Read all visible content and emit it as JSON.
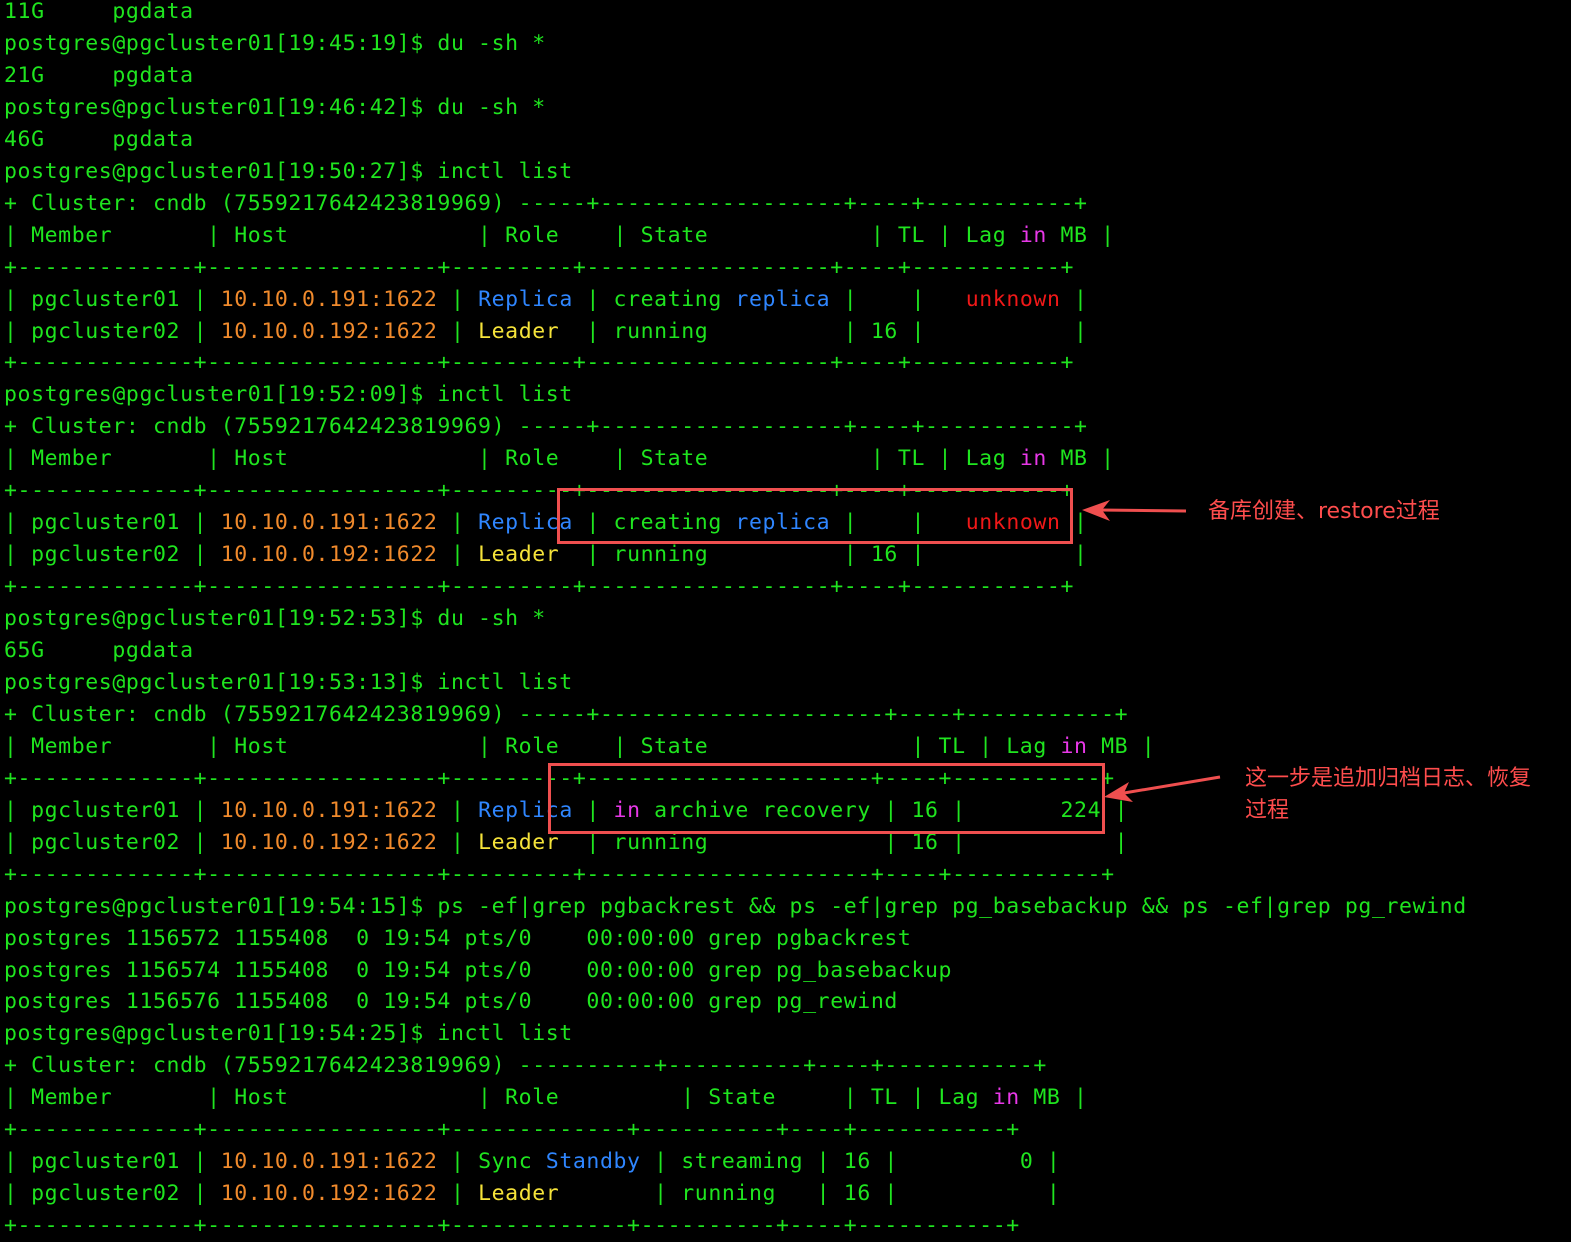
{
  "colors": {
    "background": "#000000",
    "green": "#1fe51f",
    "orange": "#f08a2c",
    "blue": "#2f86ff",
    "yellow": "#f5e33a",
    "red": "#f01818",
    "magenta": "#e838e8",
    "annotation": "#ef4f4f"
  },
  "terminal": {
    "lines": [
      [
        [
          "g",
          "11G     pgdata"
        ]
      ],
      [
        [
          "g",
          "postgres@pgcluster01[19:45:19]$ du -sh *"
        ]
      ],
      [
        [
          "g",
          "21G     pgdata"
        ]
      ],
      [
        [
          "g",
          "postgres@pgcluster01[19:46:42]$ du -sh *"
        ]
      ],
      [
        [
          "g",
          "46G     pgdata"
        ]
      ],
      [
        [
          "g",
          "postgres@pgcluster01[19:50:27]$ inctl list"
        ]
      ],
      [
        [
          "g",
          "+ Cluster: cndb (7559217642423819969) -----+------------------+----+-----------+"
        ]
      ],
      [
        [
          "g",
          "| Member       | Host              | Role    | State            | TL | Lag "
        ],
        [
          "m",
          "in"
        ],
        [
          "g",
          " MB |"
        ]
      ],
      [
        [
          "g",
          "+-------------+-----------------+---------+------------------+----+-----------+"
        ]
      ],
      [
        [
          "g",
          "| pgcluster01 | "
        ],
        [
          "o",
          "10.10.0.191:1622"
        ],
        [
          "g",
          " | "
        ],
        [
          "b",
          "Replica"
        ],
        [
          "g",
          " | creating "
        ],
        [
          "b",
          "replica"
        ],
        [
          "g",
          " |    |   "
        ],
        [
          "r",
          "unknown"
        ],
        [
          "g",
          " |"
        ]
      ],
      [
        [
          "g",
          "| pgcluster02 | "
        ],
        [
          "o",
          "10.10.0.192:1622"
        ],
        [
          "g",
          " | "
        ],
        [
          "y",
          "Leader"
        ],
        [
          "g",
          "  | running          | 16 |           |"
        ]
      ],
      [
        [
          "g",
          "+-------------+-----------------+---------+------------------+----+-----------+"
        ]
      ],
      [
        [
          "g",
          "postgres@pgcluster01[19:52:09]$ inctl list"
        ]
      ],
      [
        [
          "g",
          "+ Cluster: cndb (7559217642423819969) -----+------------------+----+-----------+"
        ]
      ],
      [
        [
          "g",
          "| Member       | Host              | Role    | State            | TL | Lag "
        ],
        [
          "m",
          "in"
        ],
        [
          "g",
          " MB |"
        ]
      ],
      [
        [
          "g",
          "+-------------+-----------------+---------+------------------+----+-----------+"
        ]
      ],
      [
        [
          "g",
          "| pgcluster01 | "
        ],
        [
          "o",
          "10.10.0.191:1622"
        ],
        [
          "g",
          " | "
        ],
        [
          "b",
          "Replica"
        ],
        [
          "g",
          " | creating "
        ],
        [
          "b",
          "replica"
        ],
        [
          "g",
          " |    |   "
        ],
        [
          "r",
          "unknown"
        ],
        [
          "g",
          " |"
        ]
      ],
      [
        [
          "g",
          "| pgcluster02 | "
        ],
        [
          "o",
          "10.10.0.192:1622"
        ],
        [
          "g",
          " | "
        ],
        [
          "y",
          "Leader"
        ],
        [
          "g",
          "  | running          | 16 |           |"
        ]
      ],
      [
        [
          "g",
          "+-------------+-----------------+---------+------------------+----+-----------+"
        ]
      ],
      [
        [
          "g",
          "postgres@pgcluster01[19:52:53]$ du -sh *"
        ]
      ],
      [
        [
          "g",
          "65G     pgdata"
        ]
      ],
      [
        [
          "g",
          "postgres@pgcluster01[19:53:13]$ inctl list"
        ]
      ],
      [
        [
          "g",
          "+ Cluster: cndb (7559217642423819969) -----+---------------------+----+-----------+"
        ]
      ],
      [
        [
          "g",
          "| Member       | Host              | Role    | State               | TL | Lag "
        ],
        [
          "m",
          "in"
        ],
        [
          "g",
          " MB |"
        ]
      ],
      [
        [
          "g",
          "+-------------+-----------------+---------+---------------------+----+-----------+"
        ]
      ],
      [
        [
          "g",
          "| pgcluster01 | "
        ],
        [
          "o",
          "10.10.0.191:1622"
        ],
        [
          "g",
          " | "
        ],
        [
          "b",
          "Replica"
        ],
        [
          "g",
          " | "
        ],
        [
          "m",
          "in"
        ],
        [
          "g",
          " archive recovery | 16 |       224 |"
        ]
      ],
      [
        [
          "g",
          "| pgcluster02 | "
        ],
        [
          "o",
          "10.10.0.192:1622"
        ],
        [
          "g",
          " | "
        ],
        [
          "y",
          "Leader"
        ],
        [
          "g",
          "  | running             | 16 |           |"
        ]
      ],
      [
        [
          "g",
          "+-------------+-----------------+---------+---------------------+----+-----------+"
        ]
      ],
      [
        [
          "g",
          "postgres@pgcluster01[19:54:15]$ ps -ef|grep pgbackrest && ps -ef|grep pg_basebackup && ps -ef|grep pg_rewind"
        ]
      ],
      [
        [
          "g",
          "postgres 1156572 1155408  0 19:54 pts/0    00:00:00 grep pgbackrest"
        ]
      ],
      [
        [
          "g",
          "postgres 1156574 1155408  0 19:54 pts/0    00:00:00 grep pg_basebackup"
        ]
      ],
      [
        [
          "g",
          "postgres 1156576 1155408  0 19:54 pts/0    00:00:00 grep pg_rewind"
        ]
      ],
      [
        [
          "g",
          "postgres@pgcluster01[19:54:25]$ inctl list"
        ]
      ],
      [
        [
          "g",
          "+ Cluster: cndb (7559217642423819969) ----------+----------+----+-----------+"
        ]
      ],
      [
        [
          "g",
          "| Member       | Host              | Role         | State     | TL | Lag "
        ],
        [
          "m",
          "in"
        ],
        [
          "g",
          " MB |"
        ]
      ],
      [
        [
          "g",
          "+-------------+-----------------+-------------+----------+----+-----------+"
        ]
      ],
      [
        [
          "g",
          "| pgcluster01 | "
        ],
        [
          "o",
          "10.10.0.191:1622"
        ],
        [
          "g",
          " | Sync "
        ],
        [
          "b",
          "Standby"
        ],
        [
          "g",
          " | streaming | 16 |         0 |"
        ]
      ],
      [
        [
          "g",
          "| pgcluster02 | "
        ],
        [
          "o",
          "10.10.0.192:1622"
        ],
        [
          "g",
          " | "
        ],
        [
          "y",
          "Leader"
        ],
        [
          "g",
          "       | running   | 16 |           |"
        ]
      ],
      [
        [
          "g",
          "+-------------+-----------------+-------------+----------+----+-----------+"
        ]
      ]
    ]
  },
  "annotations": {
    "first": "备库创建、restore过程",
    "second": "这一步是追加归档日志、恢复过程"
  }
}
